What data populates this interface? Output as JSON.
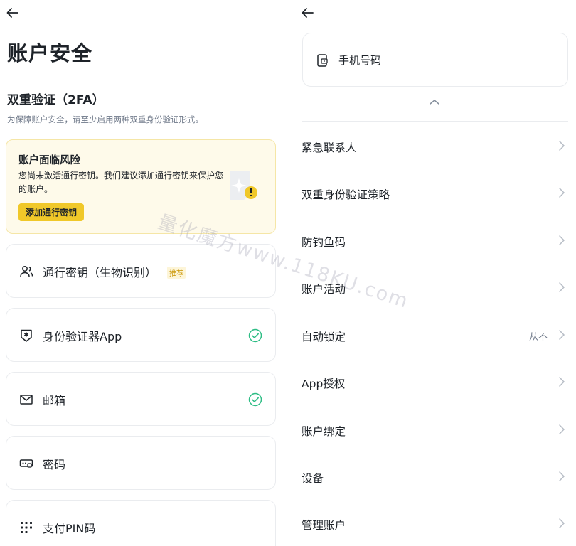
{
  "left": {
    "title": "账户安全",
    "section_title": "双重验证（2FA）",
    "section_desc": "为保障账户安全，请至少启用两种双重身份验证形式。",
    "risk": {
      "title": "账户面临风险",
      "desc": "您尚未激活通行密钥。我们建议添加通行密钥来保护您的账户。",
      "button": "添加通行密钥"
    },
    "methods": [
      {
        "label": "通行密钥（生物识别）",
        "tag": "推荐",
        "icon": "user-group-icon"
      },
      {
        "label": "身份验证器App",
        "icon": "authenticator-shield-icon",
        "status": "enabled"
      },
      {
        "label": "邮箱",
        "icon": "mail-icon",
        "status": "enabled"
      },
      {
        "label": "密码",
        "icon": "password-icon"
      },
      {
        "label": "支付PIN码",
        "icon": "pin-keypad-icon"
      }
    ]
  },
  "right": {
    "phone_label": "手机号码",
    "rows": [
      {
        "label": "紧急联系人"
      },
      {
        "label": "双重身份验证策略"
      },
      {
        "label": "防钓鱼码"
      },
      {
        "label": "账户活动"
      },
      {
        "label": "自动锁定",
        "value": "从不"
      },
      {
        "label": "App授权"
      },
      {
        "label": "账户绑定"
      },
      {
        "label": "设备"
      },
      {
        "label": "管理账户"
      }
    ]
  },
  "watermark": "量化魔方www.118KU.com",
  "colors": {
    "accent": "#f0c829",
    "success": "#2ebd85",
    "text": "#1e2329",
    "muted": "#707a8a"
  }
}
